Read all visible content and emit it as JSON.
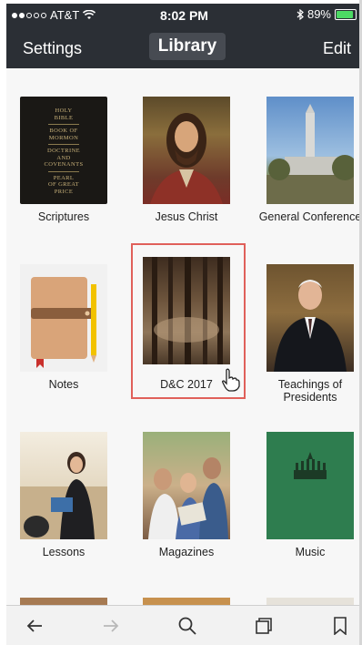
{
  "status": {
    "carrier": "AT&T",
    "time": "8:02 PM",
    "battery": "89%",
    "battery_fill": 0.89
  },
  "nav": {
    "left": "Settings",
    "title": "Library",
    "right": "Edit"
  },
  "scriptures_cover": {
    "lines": [
      "HOLY",
      "BIBLE",
      "BOOK OF",
      "MORMON",
      "DOCTRINE",
      "AND",
      "COVENANTS",
      "PEARL",
      "OF GREAT",
      "PRICE"
    ]
  },
  "library": [
    {
      "label": "Scriptures"
    },
    {
      "label": "Jesus Christ"
    },
    {
      "label": "General Conference"
    },
    {
      "label": "Notes"
    },
    {
      "label": "D&C 2017"
    },
    {
      "label": "Teachings of Presidents"
    },
    {
      "label": "Lessons"
    },
    {
      "label": "Magazines"
    },
    {
      "label": "Music"
    }
  ],
  "icons": {
    "back": "back-arrow-icon",
    "forward": "forward-arrow-icon",
    "search": "search-icon",
    "tabs": "tabs-icon",
    "bookmark": "bookmark-icon",
    "pointer": "hand-pointer-icon"
  },
  "colors": {
    "header_bg": "#2b2f35",
    "highlight_border": "#e0605a",
    "music_green": "#2e7d4f"
  }
}
